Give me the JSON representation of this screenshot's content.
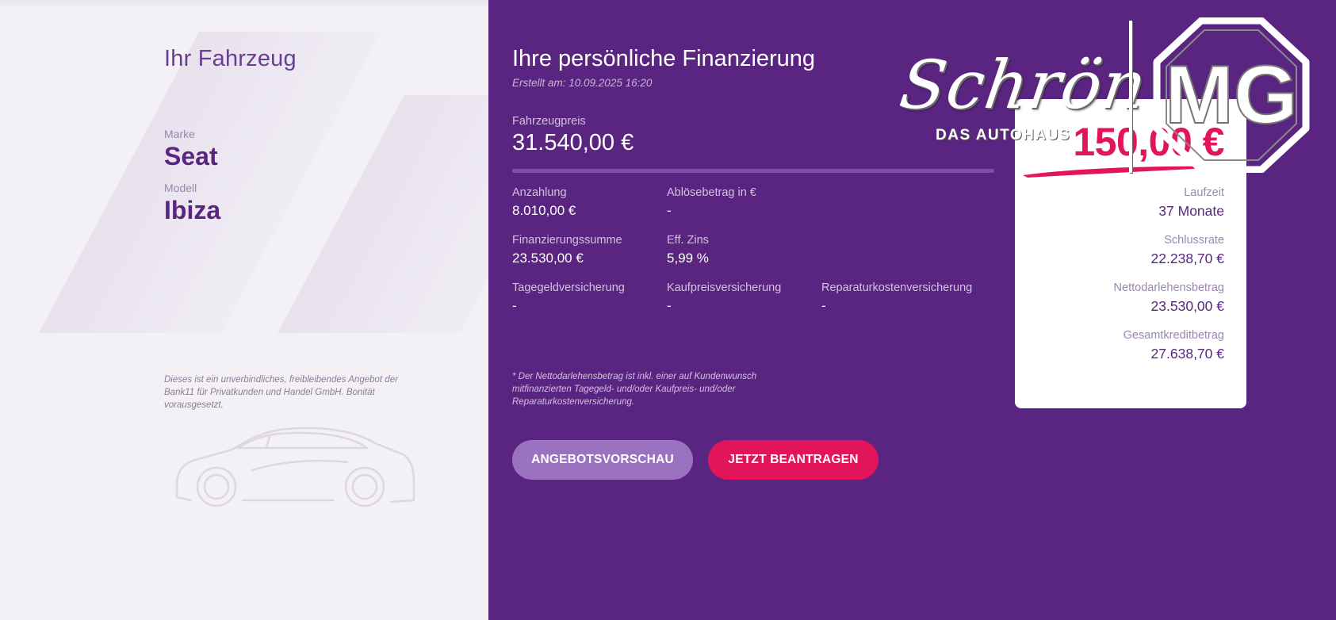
{
  "vehicle": {
    "title": "Ihr Fahrzeug",
    "brand_label": "Marke",
    "brand": "Seat",
    "model_label": "Modell",
    "model": "Ibiza",
    "disclaimer": "Dieses ist ein unverbindliches, freibleibendes Angebot der Bank11 für Privatkunden und Handel GmbH. Bonität vorausgesetzt."
  },
  "financing": {
    "title": "Ihre persönliche Finanzierung",
    "created": "Erstellt am: 10.09.2025 16:20",
    "price_label": "Fahrzeugpreis",
    "price": "31.540,00 €",
    "fields": [
      {
        "label": "Anzahlung",
        "value": "8.010,00 €"
      },
      {
        "label": "Ablösebetrag in €",
        "value": "-"
      },
      {
        "label": "Finanzierungssumme",
        "value": "23.530,00 €"
      },
      {
        "label": "Eff. Zins",
        "value": "5,99 %"
      },
      {
        "label": "Tagegeldversicherung",
        "value": "-"
      },
      {
        "label": "Kaufpreisversicherung",
        "value": "-"
      },
      {
        "label": "Reparaturkostenversicherung",
        "value": "-"
      }
    ],
    "footnote": "* Der Nettodarlehensbetrag ist inkl. einer auf Kundenwunsch mitfinanzierten Tagegeld- und/oder Kaufpreis- und/oder Reparaturkostenversicherung.",
    "buttons": {
      "preview": "ANGEBOTSVORSCHAU",
      "apply": "JETZT BEANTRAGEN"
    }
  },
  "summary": {
    "monthly_rate": "150,00 €",
    "rows": [
      {
        "label": "Laufzeit",
        "value": "37 Monate"
      },
      {
        "label": "Schlussrate",
        "value": "22.238,70 €"
      },
      {
        "label": "Nettodarlehensbetrag",
        "value": "23.530,00 €"
      },
      {
        "label": "Gesamtkreditbetrag",
        "value": "27.638,70 €"
      }
    ]
  },
  "logo": {
    "script": "Schrön",
    "subtitle": "DAS AUTOHAUS",
    "badge": "MG"
  },
  "colors": {
    "purple": "#5a2580",
    "accent": "#e2145a",
    "panel": "#f3f0f6",
    "button_secondary": "#9a72c0"
  }
}
